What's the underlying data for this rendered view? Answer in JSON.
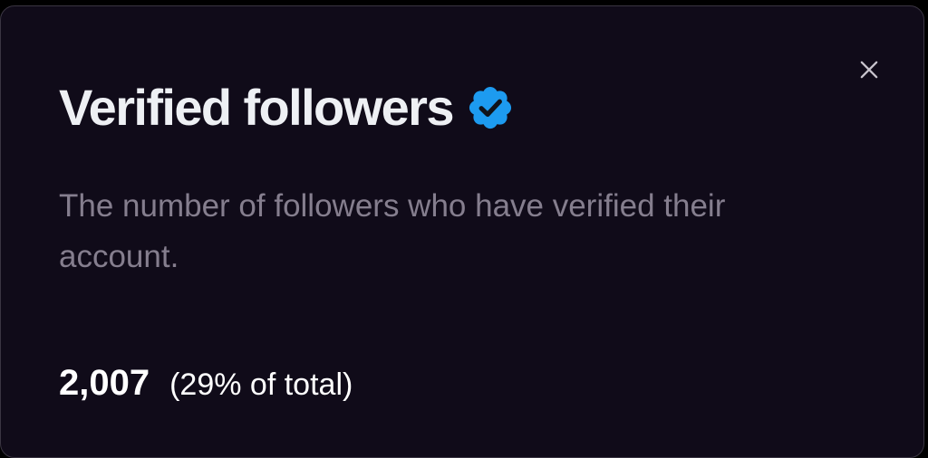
{
  "dialog": {
    "title": "Verified followers",
    "title_icon": "verified-badge-icon",
    "close_icon": "close-icon",
    "description": "The number of followers who have verified their account.",
    "count": "2,007",
    "percent_text": "(29% of total)"
  },
  "colors": {
    "background": "#100b19",
    "title": "#eef0f4",
    "description": "#857e8e",
    "badge": "#1d9bf0",
    "close_icon": "#c7c3cc"
  }
}
